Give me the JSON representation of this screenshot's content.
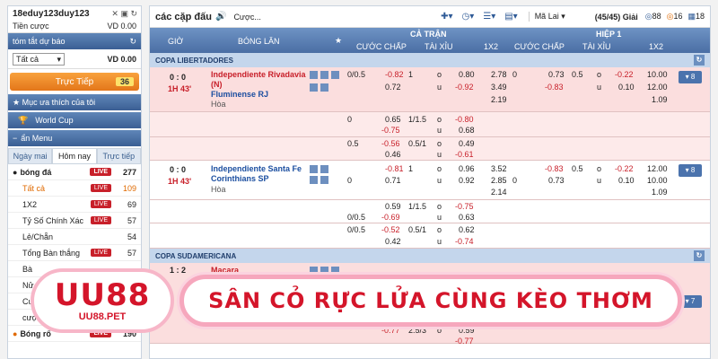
{
  "sidebar": {
    "username": "18eduy123duy123",
    "cash_label": "Tiền cược",
    "cash_value": "VD 0.00",
    "summary_label": "tóm tắt dự báo",
    "filter_value": "Tất cả",
    "filter_amount": "VD 0.00",
    "live_label": "Trực Tiếp",
    "live_count": "36",
    "favorites_label": "Mục ưa thích của tôi",
    "worldcup_label": "World Cup",
    "menu_label": "ẩn Menu",
    "tabs": [
      "Ngày mai",
      "Hôm nay",
      "Trực tiếp"
    ],
    "items": [
      {
        "label": "bóng đá",
        "live": "LIVE",
        "count": "277"
      },
      {
        "label": "Tất cả",
        "live": "LIVE",
        "count": "109"
      },
      {
        "label": "1X2",
        "live": "LIVE",
        "count": "69"
      },
      {
        "label": "Tỷ Số Chính Xác",
        "live": "LIVE",
        "count": "57"
      },
      {
        "label": "Lẻ/Chẵn",
        "live": "",
        "count": "54"
      },
      {
        "label": "Tổng Bàn thắng",
        "live": "LIVE",
        "count": "57"
      },
      {
        "label": "Bà",
        "live": "",
        "count": ""
      },
      {
        "label": "Nử",
        "live": "",
        "count": ""
      },
      {
        "label": "Cuộ",
        "live": "",
        "count": ""
      },
      {
        "label": "cược đội vô địch",
        "live": "",
        "count": "168"
      },
      {
        "label": "Bóng rổ",
        "live": "LIVE",
        "count": "190"
      }
    ]
  },
  "toolbar": {
    "title": "các cặp đấu",
    "bet_label": "Cược...",
    "region": "Mã Lai",
    "count": "(45/45) Giải",
    "c88": "88",
    "c16": "16",
    "c18": "18"
  },
  "header": {
    "time": "GIỜ",
    "team": "BÓNG LĂN",
    "full": "CẢ TRẬN",
    "half": "HIỆP 1",
    "hdp": "CƯỚC CHẤP",
    "ou": "TÀI XỈU",
    "x12": "1X2",
    "hdp2": "CƯỚC CHẤP",
    "ou2": "TÀI XỈU",
    "x122": "1X2"
  },
  "leagues": [
    "COPA LIBERTADORES",
    "COPA SUDAMERICANA"
  ],
  "matches": [
    {
      "score": "0 : 0",
      "time": "1H 43'",
      "home": "Independiente Rivadavia (N)",
      "away": "Fluminense RJ",
      "draw": "Hòa",
      "more": "▾ 8"
    },
    {
      "score": "0 : 0",
      "time": "1H 43'",
      "home": "Independiente Santa Fe",
      "away": "Corinthians SP",
      "draw": "Hòa",
      "more": "▾ 8"
    },
    {
      "score": "1 : 2",
      "time": "",
      "home": "Macara",
      "away": "",
      "draw": "",
      "more": "▾ 7"
    }
  ],
  "odds1": {
    "r1": [
      "0/0.5",
      "-0.82",
      "1",
      "o",
      "0.80",
      "2.78",
      "0",
      "0.73",
      "0.5",
      "o",
      "-0.22",
      "10.00"
    ],
    "r2": [
      "0.72",
      "u",
      "-0.92",
      "3.49",
      "-0.83",
      "u",
      "0.10",
      "12.00"
    ],
    "r3": [
      "2.19",
      "1.09"
    ],
    "a1": [
      "0",
      "0.65",
      "1/1.5",
      "o",
      "-0.80"
    ],
    "a2": [
      "-0.75",
      "u",
      "0.68"
    ],
    "b1": [
      "0.5",
      "-0.56",
      "0.5/1",
      "o",
      "0.49"
    ],
    "b2": [
      "0.46",
      "u",
      "-0.61"
    ]
  },
  "odds2": {
    "r1": [
      "-0.81",
      "1",
      "o",
      "0.96",
      "3.52",
      "-0.83",
      "0.5",
      "o",
      "-0.22",
      "12.00"
    ],
    "r2": [
      "0",
      "0.71",
      "u",
      "0.92",
      "2.85",
      "0",
      "0.73",
      "u",
      "0.10",
      "10.00"
    ],
    "r3": [
      "2.14",
      "1.09"
    ],
    "a1": [
      "0.59",
      "1/1.5",
      "o",
      "-0.75"
    ],
    "a2": [
      "0/0.5",
      "-0.69",
      "u",
      "0.63"
    ],
    "b1": [
      "0/0.5",
      "-0.52",
      "0.5/1",
      "o",
      "0.62"
    ],
    "b2": [
      "0.42",
      "u",
      "-0.74"
    ]
  },
  "odds3": {
    "a1": [
      "-0.77",
      "2.5/3",
      "o",
      "0.59"
    ],
    "a2": [
      "-0.77"
    ],
    "a3": [
      "3/3.5",
      "o",
      "-0.68"
    ]
  },
  "banner": {
    "logo": "UU88",
    "url": "UU88.PET",
    "slogan": "SÂN CỎ RỰC LỬA CÙNG KÈO THƠM"
  }
}
